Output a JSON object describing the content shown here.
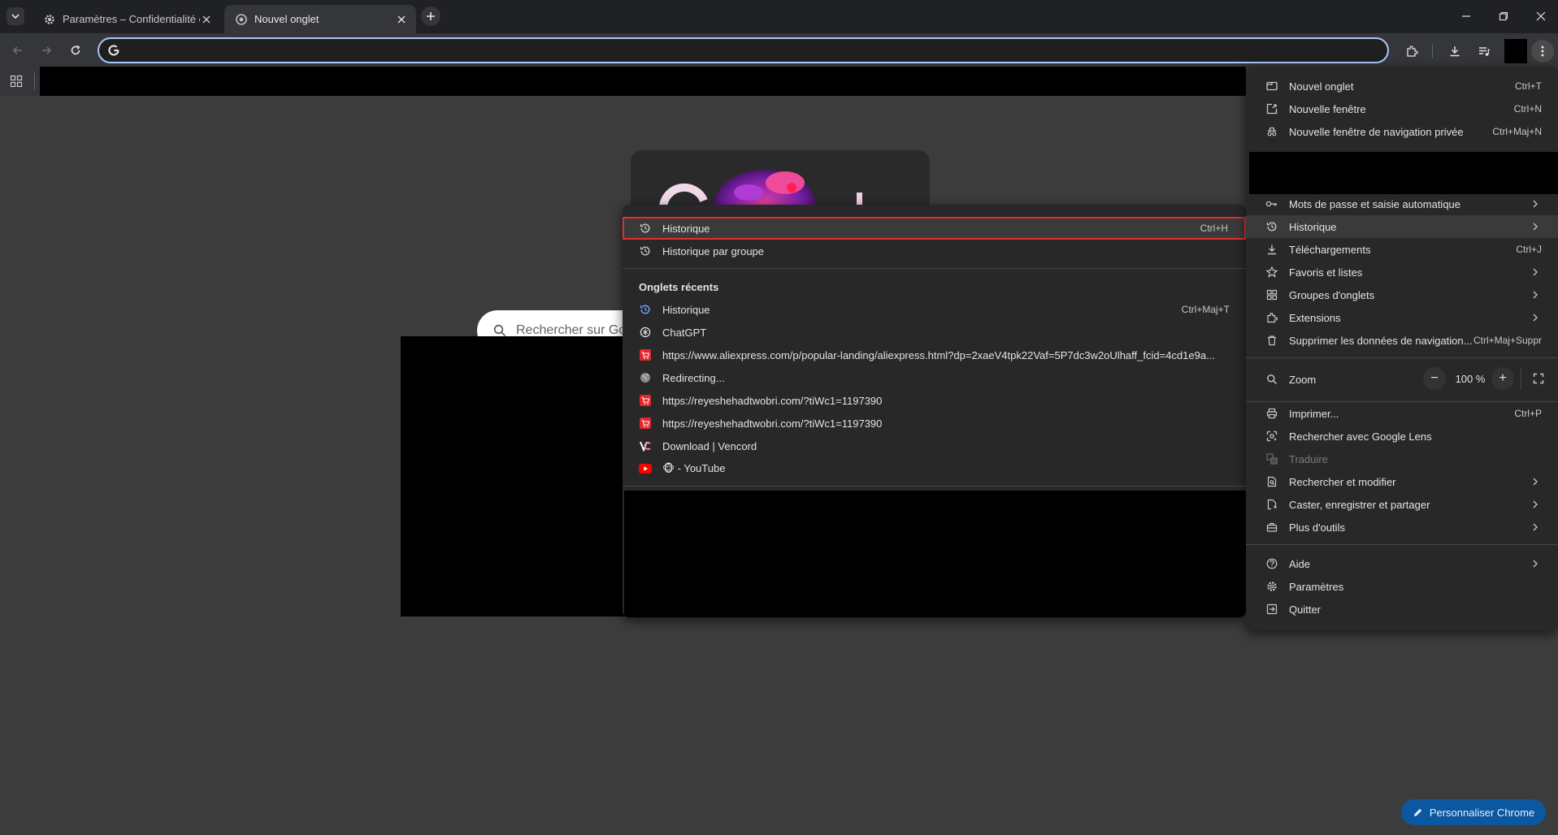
{
  "tabs": [
    {
      "title": "Paramètres – Confidentialité et",
      "icon": "gear-icon"
    },
    {
      "title": "Nouvel onglet",
      "icon": "chrome-icon"
    }
  ],
  "ntp": {
    "search_placeholder": "Rechercher sur Go"
  },
  "main_menu": {
    "items_top": [
      {
        "label": "Nouvel onglet",
        "shortcut": "Ctrl+T"
      },
      {
        "label": "Nouvelle fenêtre",
        "shortcut": "Ctrl+N"
      },
      {
        "label": "Nouvelle fenêtre de navigation privée",
        "shortcut": "Ctrl+Maj+N"
      }
    ],
    "items_mid": [
      {
        "label": "Mots de passe et saisie automatique",
        "shortcut": ""
      },
      {
        "label": "Historique",
        "shortcut": ""
      },
      {
        "label": "Téléchargements",
        "shortcut": "Ctrl+J"
      },
      {
        "label": "Favoris et listes",
        "shortcut": ""
      },
      {
        "label": "Groupes d'onglets",
        "shortcut": ""
      },
      {
        "label": "Extensions",
        "shortcut": ""
      },
      {
        "label": "Supprimer les données de navigation...",
        "shortcut": "Ctrl+Maj+Suppr"
      }
    ],
    "zoom": {
      "label": "Zoom",
      "value": "100 %",
      "minus": "−",
      "plus": "+"
    },
    "items_tools": [
      {
        "label": "Imprimer...",
        "shortcut": "Ctrl+P"
      },
      {
        "label": "Rechercher avec Google Lens",
        "shortcut": ""
      },
      {
        "label": "Traduire",
        "shortcut": ""
      },
      {
        "label": "Rechercher et modifier",
        "shortcut": ""
      },
      {
        "label": "Caster, enregistrer et partager",
        "shortcut": ""
      },
      {
        "label": "Plus d'outils",
        "shortcut": ""
      }
    ],
    "items_bottom": [
      {
        "label": "Aide",
        "shortcut": ""
      },
      {
        "label": "Paramètres",
        "shortcut": ""
      },
      {
        "label": "Quitter",
        "shortcut": ""
      }
    ]
  },
  "history_menu": {
    "items": [
      {
        "label": "Historique",
        "shortcut": "Ctrl+H"
      },
      {
        "label": "Historique par groupe",
        "shortcut": ""
      }
    ],
    "recent_title": "Onglets récents",
    "recent": [
      {
        "label": "Historique",
        "shortcut": "Ctrl+Maj+T",
        "icon": "history-icon"
      },
      {
        "label": "ChatGPT",
        "shortcut": "",
        "icon": "chatgpt-icon"
      },
      {
        "label": "https://www.aliexpress.com/p/popular-landing/aliexpress.html?dp=2xaeV4tpk22Vaf=5P7dc3w2oUlhaff_fcid=4cd1e9a...",
        "shortcut": "",
        "icon": "cart-icon"
      },
      {
        "label": "Redirecting...",
        "shortcut": "",
        "icon": "globe-icon"
      },
      {
        "label": "https://reyeshehadtwobri.com/?tiWc1=1197390",
        "shortcut": "",
        "icon": "cart-icon"
      },
      {
        "label": "https://reyeshehadtwobri.com/?tiWc1=1197390",
        "shortcut": "",
        "icon": "cart-icon"
      },
      {
        "label": "Download | Vencord",
        "shortcut": "",
        "icon": "vencord-icon"
      },
      {
        "label": "🐵 - YouTube",
        "shortcut": "",
        "icon": "youtube-icon"
      }
    ]
  },
  "customize_button": {
    "label": "Personnaliser Chrome"
  },
  "colors": {
    "accent": "#a8c7fa",
    "highlight_border": "#e03030",
    "menu_bg": "#282828"
  }
}
